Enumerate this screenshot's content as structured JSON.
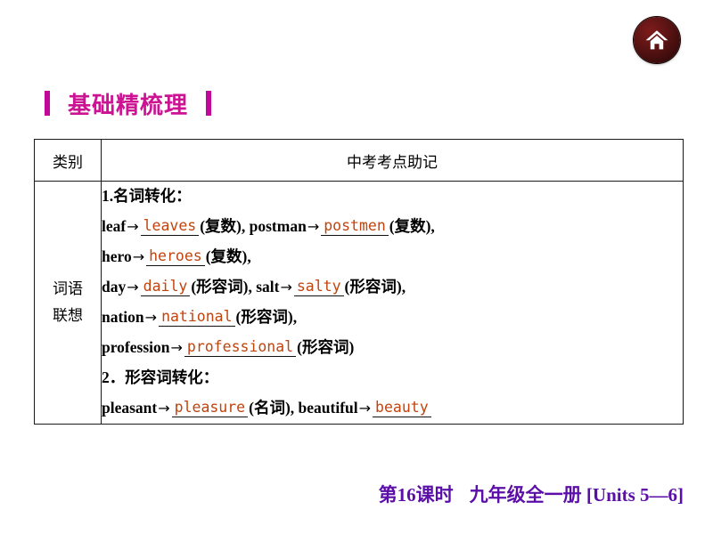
{
  "home_button": {
    "icon": "home-icon",
    "color": "#5e1414"
  },
  "section": {
    "title": "基础精梳理",
    "accent_color": "#cc1493"
  },
  "table": {
    "headers": {
      "category": "类别",
      "content": "中考考点助记"
    },
    "category_label_line1": "词语",
    "category_label_line2": "联想",
    "lines": [
      {
        "type": "heading",
        "parts": [
          {
            "kind": "text",
            "text": "1.名词转化："
          }
        ]
      },
      {
        "type": "entry",
        "parts": [
          {
            "kind": "text",
            "text": "leaf"
          },
          {
            "kind": "arrow",
            "text": "→"
          },
          {
            "kind": "answer",
            "text": "leaves"
          },
          {
            "kind": "text",
            "text": "(复数), postman"
          },
          {
            "kind": "arrow",
            "text": "→"
          },
          {
            "kind": "answer",
            "text": "postmen"
          },
          {
            "kind": "text",
            "text": "(复数),"
          }
        ]
      },
      {
        "type": "entry",
        "parts": [
          {
            "kind": "text",
            "text": "hero"
          },
          {
            "kind": "arrow",
            "text": "→"
          },
          {
            "kind": "answer",
            "text": "heroes"
          },
          {
            "kind": "text",
            "text": "(复数),"
          }
        ]
      },
      {
        "type": "entry",
        "parts": [
          {
            "kind": "text",
            "text": "day"
          },
          {
            "kind": "arrow",
            "text": "→"
          },
          {
            "kind": "answer",
            "text": "daily"
          },
          {
            "kind": "text",
            "text": "(形容词), salt"
          },
          {
            "kind": "arrow",
            "text": "→"
          },
          {
            "kind": "answer",
            "text": "salty"
          },
          {
            "kind": "text",
            "text": "(形容词),"
          }
        ]
      },
      {
        "type": "entry",
        "parts": [
          {
            "kind": "text",
            "text": "nation"
          },
          {
            "kind": "arrow",
            "text": "→"
          },
          {
            "kind": "answer",
            "text": "national"
          },
          {
            "kind": "text",
            "text": "(形容词),"
          }
        ]
      },
      {
        "type": "entry",
        "parts": [
          {
            "kind": "text",
            "text": "profession"
          },
          {
            "kind": "arrow",
            "text": "→"
          },
          {
            "kind": "answer",
            "text": "professional"
          },
          {
            "kind": "text",
            "text": "(形容词)"
          }
        ]
      },
      {
        "type": "heading",
        "parts": [
          {
            "kind": "text",
            "text": "2．形容词转化："
          }
        ]
      },
      {
        "type": "entry",
        "parts": [
          {
            "kind": "text",
            "text": "pleasant"
          },
          {
            "kind": "arrow",
            "text": "→"
          },
          {
            "kind": "answer",
            "text": "pleasure"
          },
          {
            "kind": "text",
            "text": "(名词), beautiful"
          },
          {
            "kind": "arrow",
            "text": "→"
          },
          {
            "kind": "answer",
            "text": "beauty"
          }
        ]
      }
    ],
    "answer_color": "#c1440e"
  },
  "footer": {
    "lesson": "第16课时",
    "book": "九年级全一册 [Units 5—6]",
    "color": "#5b0ea8"
  }
}
